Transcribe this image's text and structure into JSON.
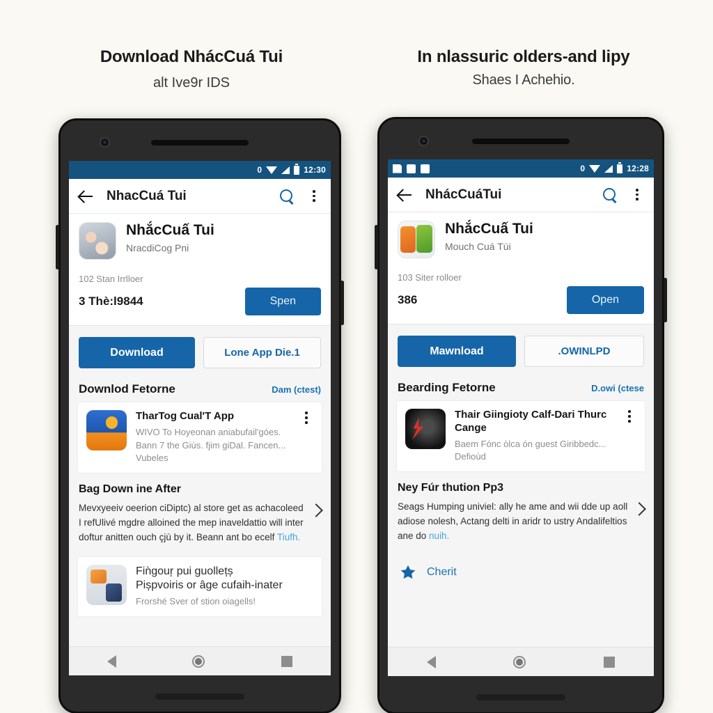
{
  "left": {
    "caption": {
      "line1": "Download NhácCuá Tui",
      "line2": "alt Ive9r IDS"
    },
    "statusbar": {
      "left_icons": [],
      "notif_count": "0",
      "time": "12:30"
    },
    "appbar": {
      "title": "NhacCuá Tui",
      "back_icon": "back-arrow-icon",
      "search_icon": "search-icon",
      "more_icon": "overflow-menu-icon"
    },
    "app": {
      "name": "NhắcCuấ Tui",
      "developer": "NracdiCog  Pni",
      "meta": "102 Stan Irrlloer",
      "count": "3 Thè:l9844",
      "open_label": "Spen",
      "icon": "app-icon-photo"
    },
    "actions": {
      "primary": "Download",
      "secondary": "Lone App Die.1"
    },
    "section": {
      "title": "Downlod Fetorne",
      "action": "Dam (ctest)"
    },
    "card": {
      "title": "TharTog Cual'T App",
      "sub_line1": "WIVO To Hoyeonan aniabufail'góes.",
      "sub_line2": "Bann 7 the Giùs. fjim giDal. Fancen...",
      "sub_line3": "Vubeles",
      "icon": "app-card-icon",
      "more_icon": "overflow-menu-icon"
    },
    "block": {
      "title": "Bag Down ine After",
      "text": "Mevxyeeiv oeerion ciDiptc) al store get as achacoleed I refUlivé mgdre alloined the mep inaveldattio will inter doftur anitten ouch çjù by it. Beann ant bo ecelf ",
      "link": "Tiufh.",
      "chevron_icon": "chevron-right-icon"
    },
    "card2": {
      "title1": "Fiǹgouŗ pui guollețș",
      "title2": "Pișpvoiris or âge cufaih-inater",
      "sub": "Frorshé Sver of stion oiagells!",
      "icon": "collage-icon"
    },
    "navbar": {
      "back": "nav-back-icon",
      "home": "nav-home-icon",
      "recent": "nav-recent-icon"
    }
  },
  "right": {
    "caption": {
      "line1": "In nlassuric olders-and lipy",
      "line2": "Shaes I Achehio."
    },
    "statusbar": {
      "left_icons": [
        "save-icon",
        "screenshot-icon",
        "face-icon"
      ],
      "notif_count": "0",
      "time": "12:28"
    },
    "appbar": {
      "title": "NhácCuáTui",
      "back_icon": "back-arrow-icon",
      "search_icon": "search-icon",
      "more_icon": "overflow-menu-icon"
    },
    "app": {
      "name": "NhắcCuấ Tui",
      "developer": "Mouch Cuá Tùi",
      "meta": "103 Siter rolloer",
      "count": "386",
      "open_label": "Open",
      "icon": "app-icon-green-orange"
    },
    "actions": {
      "primary": "Mawnload",
      "secondary": ".OWINLPD"
    },
    "section": {
      "title": "Bearding Fetorne",
      "action": "D.owi (ctese"
    },
    "card": {
      "title": "Thair Giingioty Calf-Dari Thurc Cange",
      "sub_line1": "Baem Fónc òlca ón guest Giribbedc...",
      "sub_line2": "Defioùd",
      "sub_line3": "",
      "icon": "app-card-icon-dark",
      "more_icon": "overflow-menu-icon"
    },
    "block": {
      "title": "Ney Fúr thution Pp3",
      "text": "Seags Humping univiel: ally he ame and wii dde up aoll adiose nolesh, Actang delti in aridr to ustry Andalifeltios ane do ",
      "link": "nuih.",
      "chevron_icon": "chevron-right-icon"
    },
    "favorite": {
      "label": "Cherit",
      "icon": "star-icon"
    },
    "navbar": {
      "back": "nav-back-icon",
      "home": "nav-home-icon",
      "recent": "nav-recent-icon"
    }
  },
  "colors": {
    "page_background": "#faf9f4",
    "status_bar": "#15537f",
    "accent_blue": "#1565a8",
    "link_blue": "#1672b5",
    "body_gray": "#f5f5f5"
  }
}
